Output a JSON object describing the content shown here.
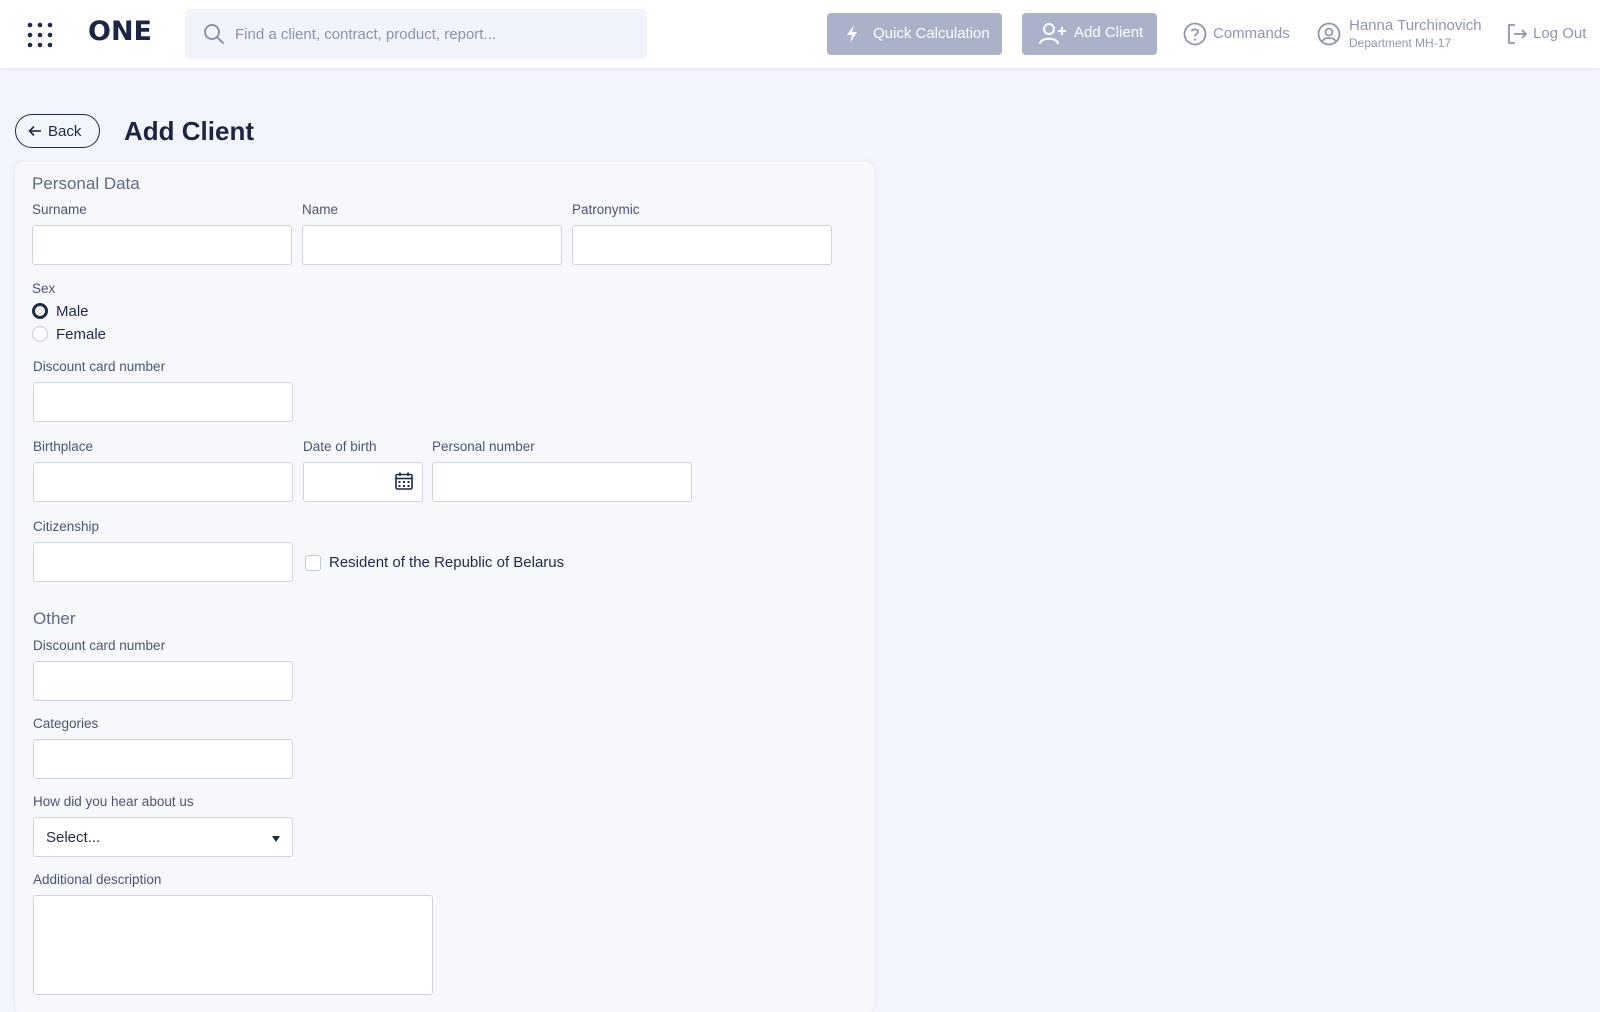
{
  "header": {
    "logo": "ONE",
    "search_placeholder": "Find a client, contract, product, report...",
    "quick_calc_label": "Quick Calculation",
    "add_client_label": "Add Client",
    "commands_label": "Commands",
    "user_name": "Hanna Turchinovich",
    "user_department": "Department MH-17",
    "logout_label": "Log Out"
  },
  "page": {
    "back_label": "Back",
    "title": "Add Client"
  },
  "personal": {
    "section_title": "Personal Data",
    "surname_label": "Surname",
    "name_label": "Name",
    "patronymic_label": "Patronymic",
    "sex_label": "Sex",
    "sex_options": [
      "Male",
      "Female"
    ],
    "sex_selected": "Male",
    "discount_label": "Discount card number",
    "birthplace_label": "Birthplace",
    "dob_label": "Date of birth",
    "personal_number_label": "Personal number",
    "citizenship_label": "Citizenship",
    "resident_label": "Resident of the Republic of Belarus",
    "resident_checked": false
  },
  "other": {
    "section_title": "Other",
    "discount_label": "Discount card number",
    "categories_label": "Categories",
    "hear_label": "How did you hear about us",
    "hear_value": "Select...",
    "description_label": "Additional description"
  },
  "colors": {
    "accent": "#1f2a44",
    "button_bg": "#aab1c9",
    "page_bg": "#f2f5fb"
  },
  "icons": {
    "apps": "apps-grid-icon",
    "search": "search-icon",
    "quick_calc": "lightning-icon",
    "add_client": "add-user-icon",
    "commands": "question-circle-icon",
    "user": "user-circle-icon",
    "logout": "logout-icon",
    "back": "arrow-left-icon",
    "calendar": "calendar-icon",
    "select": "chevron-down-icon"
  }
}
